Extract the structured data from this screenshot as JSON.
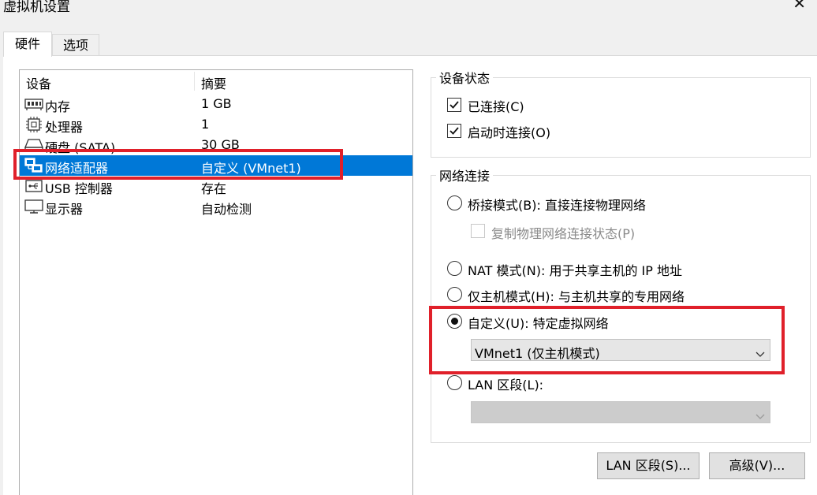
{
  "window": {
    "title": "虚拟机设置",
    "close_glyph": "✕"
  },
  "tabs": [
    {
      "label": "硬件",
      "active": true
    },
    {
      "label": "选项",
      "active": false
    }
  ],
  "device_list": {
    "columns": {
      "device": "设备",
      "summary": "摘要"
    },
    "rows": [
      {
        "name": "内存",
        "summary": "1 GB",
        "icon": "memory-icon",
        "selected": false
      },
      {
        "name": "处理器",
        "summary": "1",
        "icon": "processor-icon",
        "selected": false
      },
      {
        "name": "硬盘 (SATA)",
        "summary": "30 GB",
        "icon": "hard-disk-icon",
        "selected": false
      },
      {
        "name": "网络适配器",
        "summary": "自定义 (VMnet1)",
        "icon": "network-adapter-icon",
        "selected": true
      },
      {
        "name": "USB 控制器",
        "summary": "存在",
        "icon": "usb-icon",
        "selected": false
      },
      {
        "name": "显示器",
        "summary": "自动检测",
        "icon": "display-icon",
        "selected": false
      }
    ]
  },
  "device_status": {
    "title": "设备状态",
    "connected": {
      "label": "已连接(C)",
      "checked": true
    },
    "connect_at_power_on": {
      "label": "启动时连接(O)",
      "checked": true
    }
  },
  "network_connection": {
    "title": "网络连接",
    "bridged": {
      "label": "桥接模式(B): 直接连接物理网络",
      "selected": false
    },
    "replicate": {
      "label": "复制物理网络连接状态(P)",
      "checked": false,
      "disabled": true
    },
    "nat": {
      "label": "NAT 模式(N): 用于共享主机的 IP 地址",
      "selected": false
    },
    "host_only": {
      "label": "仅主机模式(H): 与主机共享的专用网络",
      "selected": false
    },
    "custom": {
      "label": "自定义(U): 特定虚拟网络",
      "selected": true
    },
    "custom_select_value": "VMnet1 (仅主机模式)",
    "lan_segment": {
      "label": "LAN 区段(L):",
      "selected": false
    },
    "lan_select_value": ""
  },
  "buttons": {
    "lan_segments": "LAN 区段(S)...",
    "advanced": "高级(V)..."
  },
  "colors": {
    "selection": "#0078d7",
    "highlight_annotation": "#e0202a"
  }
}
